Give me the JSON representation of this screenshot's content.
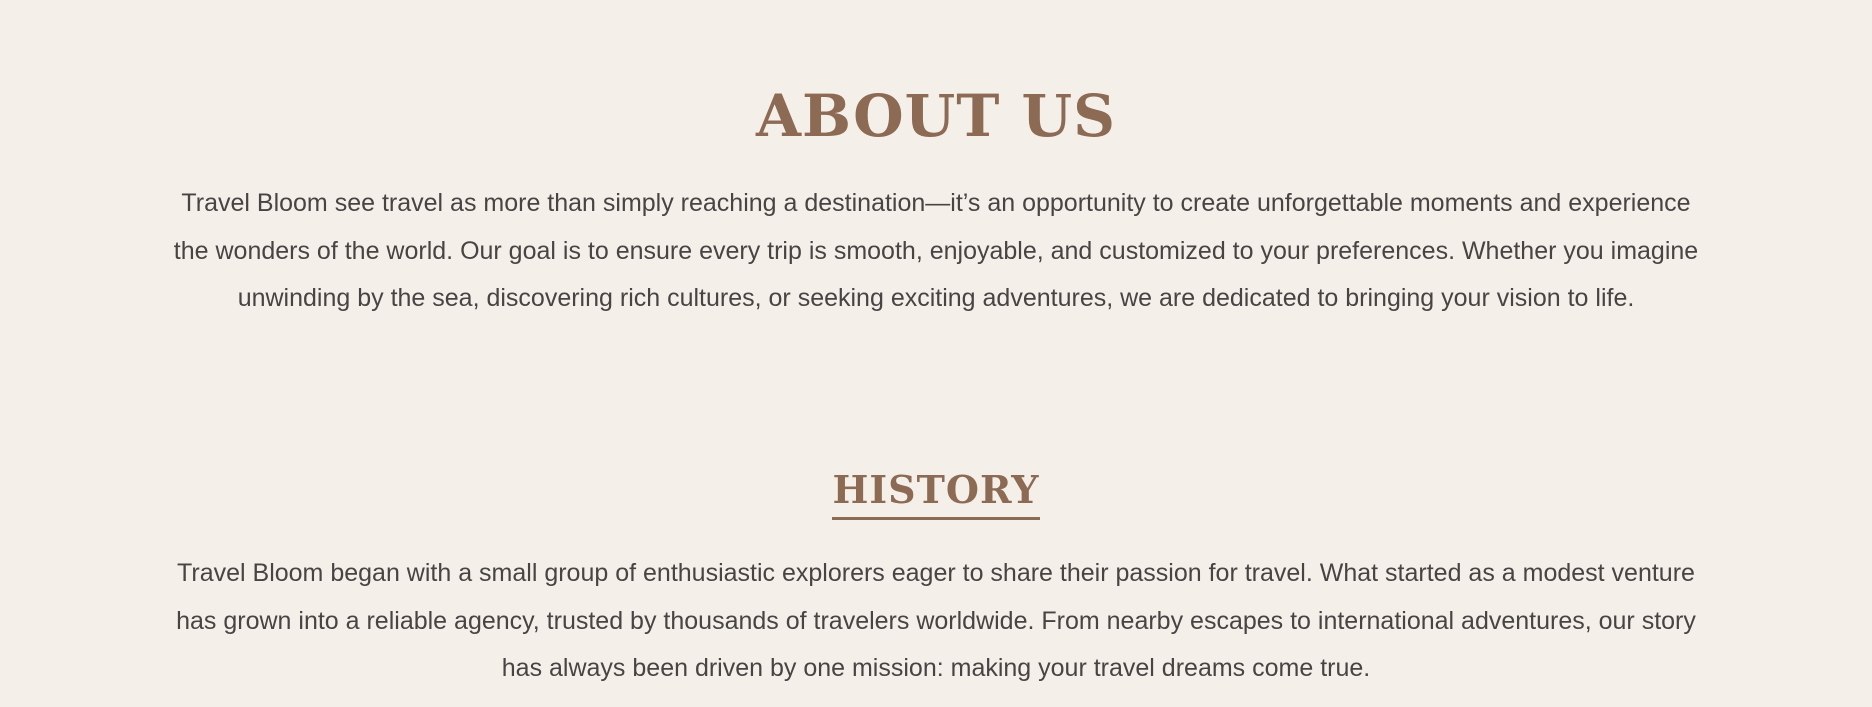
{
  "about": {
    "title": "ABOUT US",
    "text": "Travel Bloom see travel as more than simply reaching a destination—it’s an opportunity to create unforgettable moments and experience the wonders of the world. Our goal is to ensure every trip is smooth, enjoyable, and customized to your preferences. Whether you imagine unwinding by the sea, discovering rich cultures, or seeking exciting adventures, we are dedicated to bringing your vision to life."
  },
  "history": {
    "title": "HISTORY",
    "text": "Travel Bloom began with a small group of enthusiastic explorers eager to share their passion for travel. What started as a modest venture has grown into a reliable agency, trusted by thousands of travelers worldwide. From nearby escapes to international adventures, our story has always been driven by one mission: making your travel dreams come true."
  },
  "colors": {
    "background": "#f4f0e9",
    "heading": "#8d6a54",
    "body_text": "#474443"
  }
}
